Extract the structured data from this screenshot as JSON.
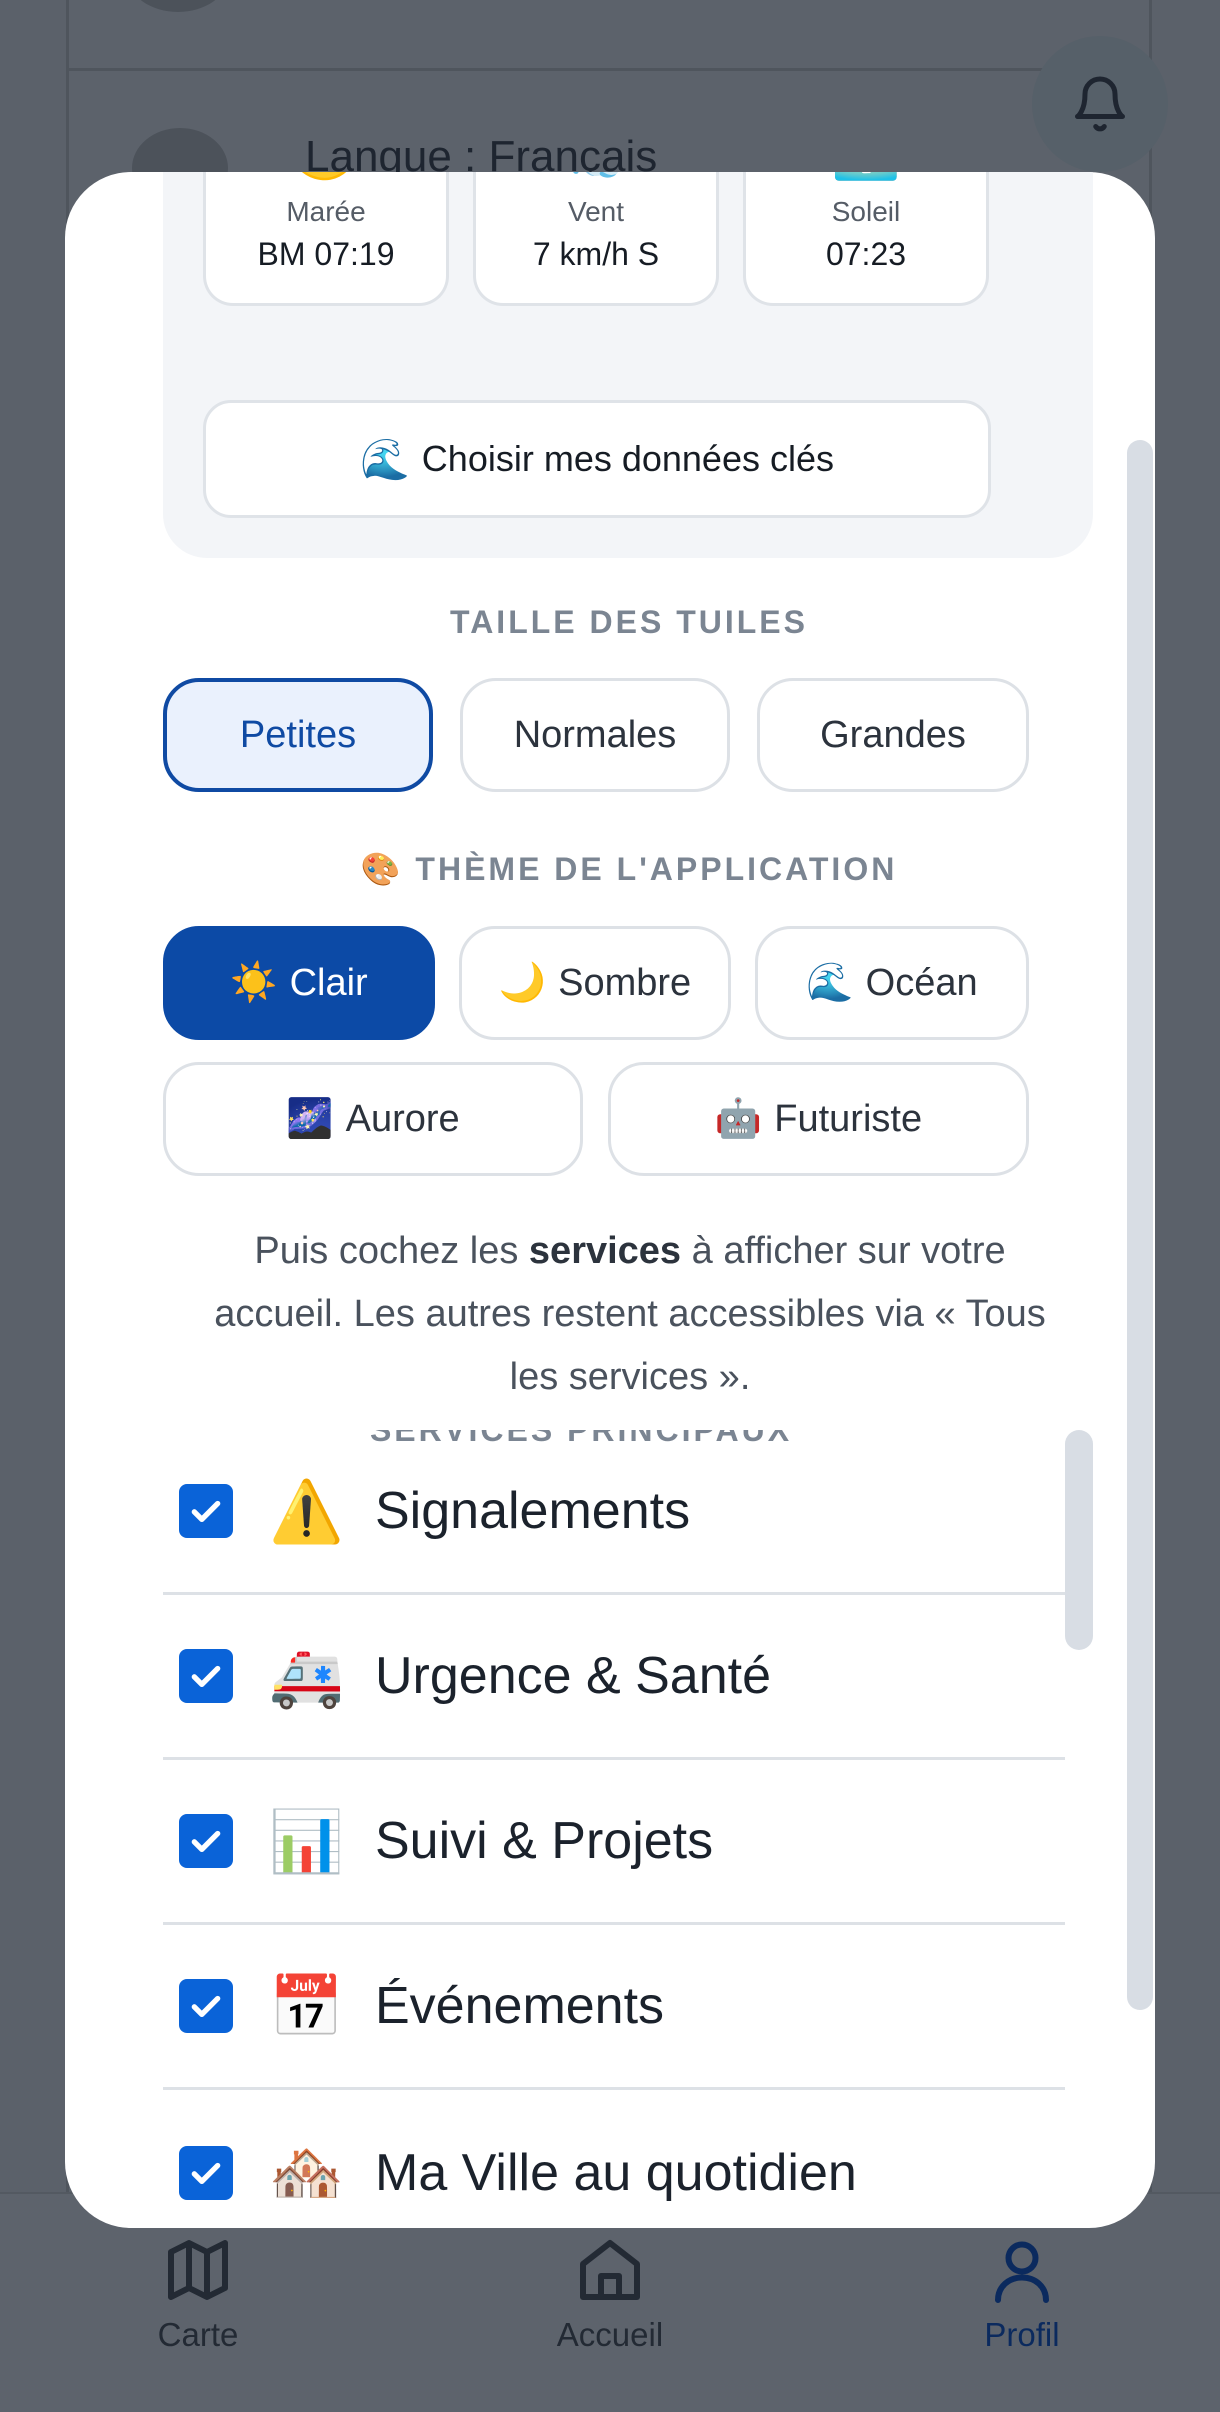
{
  "background": {
    "language_label": "Langue : Français"
  },
  "nav": {
    "items": [
      {
        "label": "Carte",
        "icon": "map-icon"
      },
      {
        "label": "Accueil",
        "icon": "home-icon"
      },
      {
        "label": "Profil",
        "icon": "user-icon",
        "active": true
      }
    ]
  },
  "key_data": {
    "tiles": [
      {
        "emoji": "🌙",
        "label": "Marée",
        "value": "BM 07:19"
      },
      {
        "emoji": "💨",
        "label": "Vent",
        "value": "7 km/h S"
      },
      {
        "emoji": "🌅",
        "label": "Soleil",
        "value": "07:23"
      }
    ],
    "choose_button": {
      "emoji": "🌊",
      "label": "Choisir mes données clés"
    }
  },
  "tile_size": {
    "title": "TAILLE DES TUILES",
    "options": [
      {
        "label": "Petites",
        "selected": true
      },
      {
        "label": "Normales",
        "selected": false
      },
      {
        "label": "Grandes",
        "selected": false
      }
    ]
  },
  "theme": {
    "title_emoji": "🎨",
    "title": "THÈME DE L'APPLICATION",
    "options": [
      {
        "emoji": "☀️",
        "label": "Clair",
        "selected": true
      },
      {
        "emoji": "🌙",
        "label": "Sombre",
        "selected": false
      },
      {
        "emoji": "🌊",
        "label": "Océan",
        "selected": false
      },
      {
        "emoji": "🌌",
        "label": "Aurore",
        "selected": false
      },
      {
        "emoji": "🤖",
        "label": "Futuriste",
        "selected": false
      }
    ]
  },
  "help": {
    "prefix": "Puis cochez les ",
    "bold": "services",
    "suffix": " à afficher sur votre accueil. Les autres restent accessibles via « Tous les services »."
  },
  "services": {
    "header": "SERVICES PRINCIPAUX",
    "items": [
      {
        "emoji": "⚠️",
        "label": "Signalements",
        "checked": true
      },
      {
        "emoji": "🚑",
        "label": "Urgence & Santé",
        "checked": true
      },
      {
        "emoji": "📊",
        "label": "Suivi & Projets",
        "checked": true
      },
      {
        "emoji": "📅",
        "label": "Événements",
        "checked": true
      },
      {
        "emoji": "🏘️",
        "label": "Ma Ville au quotidien",
        "checked": true
      }
    ]
  },
  "colors": {
    "accent": "#0c4aa6",
    "checkbox": "#0a63d8",
    "overlay": "#5b616a"
  }
}
